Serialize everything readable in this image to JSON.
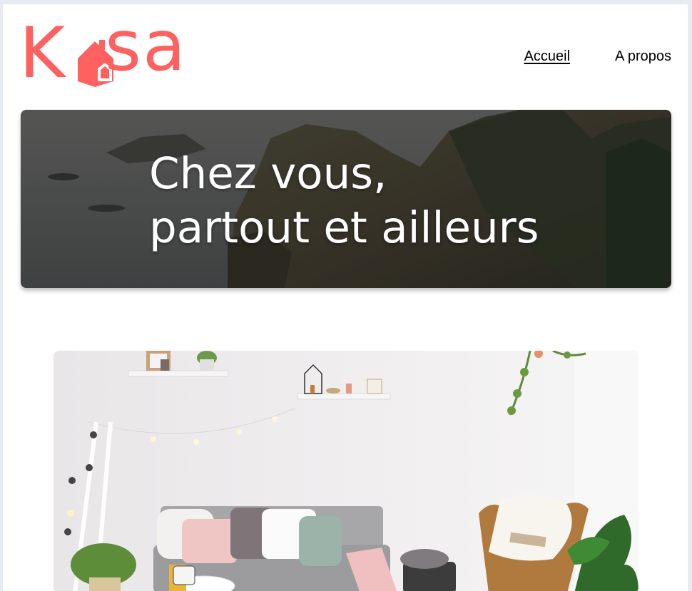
{
  "brand": {
    "name": "Kasa",
    "logo_color": "#ff6060"
  },
  "nav": {
    "items": [
      {
        "label": "Accueil",
        "active": true
      },
      {
        "label": "A propos",
        "active": false
      }
    ]
  },
  "banner": {
    "line1": "Chez vous,",
    "line2": "partout et ailleurs",
    "image": "coastal-cliffs-photo"
  },
  "hero_photo": {
    "image": "living-room-photo"
  }
}
